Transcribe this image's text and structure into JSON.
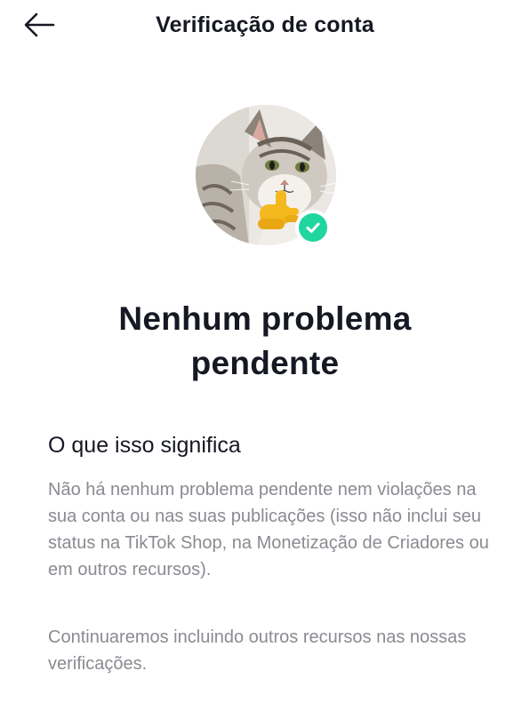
{
  "header": {
    "title": "Verificação de conta",
    "back_icon": "arrow-left-icon"
  },
  "profile": {
    "avatar": "cat-thumbs-up-avatar",
    "badge_icon": "check-icon",
    "badge_color": "#20d5a0"
  },
  "status": {
    "title_line1": "Nenhum problema",
    "title_line2": "pendente"
  },
  "info": {
    "heading": "O que isso significa",
    "paragraph_1": "Não há nenhum problema pendente nem violações na sua conta ou nas suas publicações (isso não inclui seu status na TikTok Shop, na Monetização de Criadores ou em outros recursos).",
    "paragraph_2": "Continuaremos incluindo outros recursos nas nossas verificações."
  },
  "colors": {
    "text_primary": "#161823",
    "text_secondary": "#8a8b91",
    "accent_verified": "#20d5a0"
  }
}
